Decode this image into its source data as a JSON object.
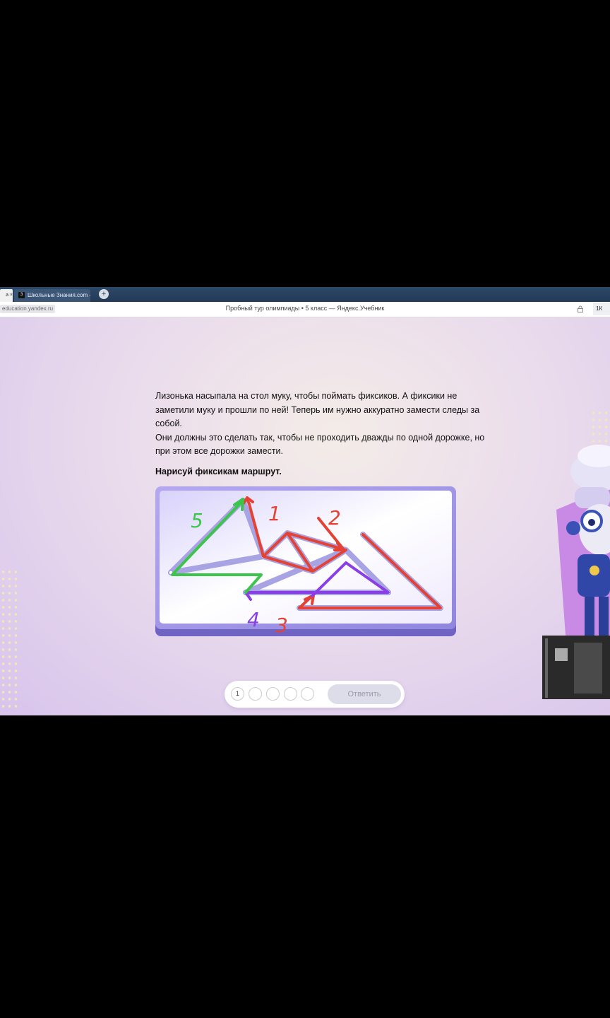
{
  "browser": {
    "prev_tab_label": "a ×",
    "tab": {
      "label": "Школьные Знания.com -",
      "favicon_text": "З"
    },
    "new_tab_symbol": "+",
    "address": "education.yandex.ru",
    "page_title": "Пробный тур олимпиады • 5 класс — Яндекс.Учебник",
    "right_button_label": "1К"
  },
  "task": {
    "paragraph1": "Лизонька насыпала на стол муку, чтобы поймать фиксиков. А фиксики не заметили муку и прошли по ней! Теперь им нужно аккуратно замести следы за собой.",
    "paragraph2": "Они должны это сделать так, чтобы не проходить дважды по одной дорожке, но при этом все дорожки замести.",
    "instruction": "Нарисуй фиксикам маршрут."
  },
  "route_labels": {
    "step1": "1",
    "step2": "2",
    "step3": "3",
    "step4": "4",
    "step5": "5"
  },
  "colors": {
    "red": "#e34234",
    "green": "#3cc54a",
    "purple": "#8a3ee6",
    "path": "#a8a4e4"
  },
  "answer_bar": {
    "questions": [
      "1",
      "",
      "",
      "",
      ""
    ],
    "submit_label": "Ответить"
  }
}
